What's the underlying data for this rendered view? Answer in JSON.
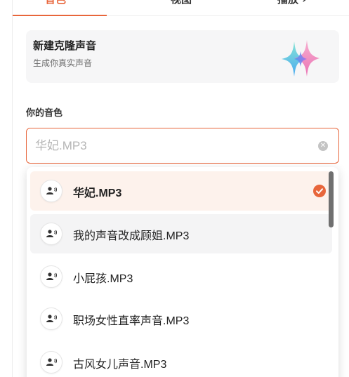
{
  "tabs": [
    {
      "label": "音色"
    },
    {
      "label": "视图"
    },
    {
      "label": "播放 ›"
    }
  ],
  "clone_card": {
    "title": "新建克隆声音",
    "subtitle": "生成你真实声音"
  },
  "voice_section": {
    "label": "你的音色"
  },
  "search": {
    "value": "",
    "placeholder": "华妃.MP3"
  },
  "voices": [
    {
      "name": "华妃.MP3",
      "selected": true
    },
    {
      "name": "我的声音改成顾姐.MP3",
      "selected": false
    },
    {
      "name": "小屁孩.MP3",
      "selected": false
    },
    {
      "name": "职场女性直率声音.MP3",
      "selected": false
    },
    {
      "name": "古风女儿声音.MP3",
      "selected": false
    }
  ],
  "colors": {
    "accent": "#e8663b",
    "selected_bg": "#fdf2ec",
    "hover_bg": "#f4f4f5",
    "card_bg": "#f6f6f7"
  }
}
